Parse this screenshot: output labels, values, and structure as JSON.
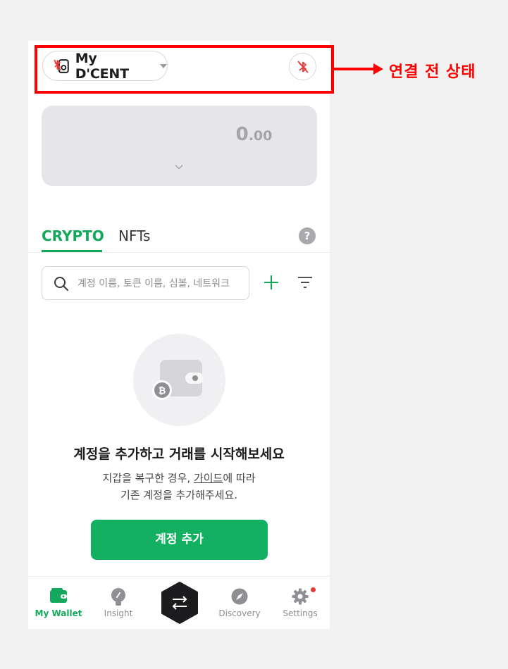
{
  "header": {
    "device_name": "My D'CENT",
    "device_icon": "device-disconnected-icon",
    "bluetooth_icon": "bluetooth-off-icon"
  },
  "annotation": {
    "text": "연결 전 상태",
    "color": "#ff0000"
  },
  "balance": {
    "integer": "0",
    "decimal": ".00"
  },
  "tabs": [
    {
      "label": "CRYPTO",
      "active": true
    },
    {
      "label": "NFTs",
      "active": false
    }
  ],
  "search": {
    "placeholder": "계정 이름, 토큰 이름, 심볼, 네트워크"
  },
  "empty_state": {
    "title": "계정을 추가하고 거래를 시작해보세요",
    "desc_before_link": "지갑을 복구한 경우, ",
    "link_text": "가이드",
    "desc_after_link": "에 따라",
    "desc_line2": "기존 계정을 추가해주세요.",
    "button_label": "계정 추가"
  },
  "nav": [
    {
      "label": "My Wallet",
      "icon": "wallet-icon",
      "active": true
    },
    {
      "label": "Insight",
      "icon": "lightbulb-icon",
      "active": false
    },
    {
      "label": "",
      "icon": "swap-icon",
      "active": false
    },
    {
      "label": "Discovery",
      "icon": "compass-icon",
      "active": false
    },
    {
      "label": "Settings",
      "icon": "gear-icon",
      "active": false,
      "notification": true
    }
  ],
  "colors": {
    "accent": "#13a85c",
    "button": "#13b061",
    "highlight": "#ff0000"
  }
}
